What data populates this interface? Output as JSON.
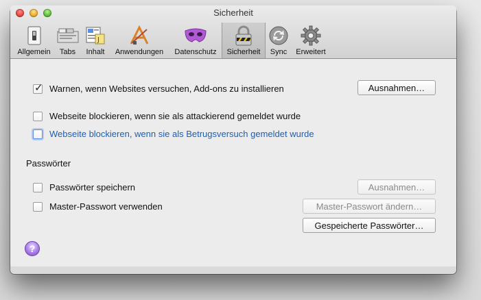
{
  "window": {
    "title": "Sicherheit"
  },
  "toolbar": {
    "items": [
      {
        "label": "Allgemein",
        "icon": "switch-icon"
      },
      {
        "label": "Tabs",
        "icon": "tabs-icon"
      },
      {
        "label": "Inhalt",
        "icon": "content-icon"
      },
      {
        "label": "Anwendungen",
        "icon": "applications-icon"
      },
      {
        "label": "Datenschutz",
        "icon": "mask-icon"
      },
      {
        "label": "Sicherheit",
        "icon": "lock-icon"
      },
      {
        "label": "Sync",
        "icon": "sync-icon"
      },
      {
        "label": "Erweitert",
        "icon": "gear-icon"
      }
    ],
    "active": "Sicherheit"
  },
  "security": {
    "warn_addons": {
      "label": "Warnen, wenn Websites versuchen, Add-ons zu installieren",
      "checked": true
    },
    "exceptions_button": "Ausnahmen…",
    "block_attack": {
      "label": "Webseite blockieren, wenn sie als attackierend gemeldet wurde",
      "checked": false
    },
    "block_fraud": {
      "label": "Webseite blockieren, wenn sie als Betrugsversuch gemeldet wurde",
      "checked": false
    }
  },
  "passwords": {
    "heading": "Passwörter",
    "save": {
      "label": "Passwörter speichern",
      "checked": false
    },
    "exceptions_button": "Ausnahmen…",
    "master": {
      "label": "Master-Passwort verwenden",
      "checked": false
    },
    "change_master_button": "Master-Passwort ändern…",
    "saved_passwords_button": "Gespeicherte Passwörter…"
  },
  "help": {
    "symbol": "?"
  },
  "colors": {
    "link_blue": "#1a5fb4",
    "active_tab": "#c6c6c6"
  }
}
